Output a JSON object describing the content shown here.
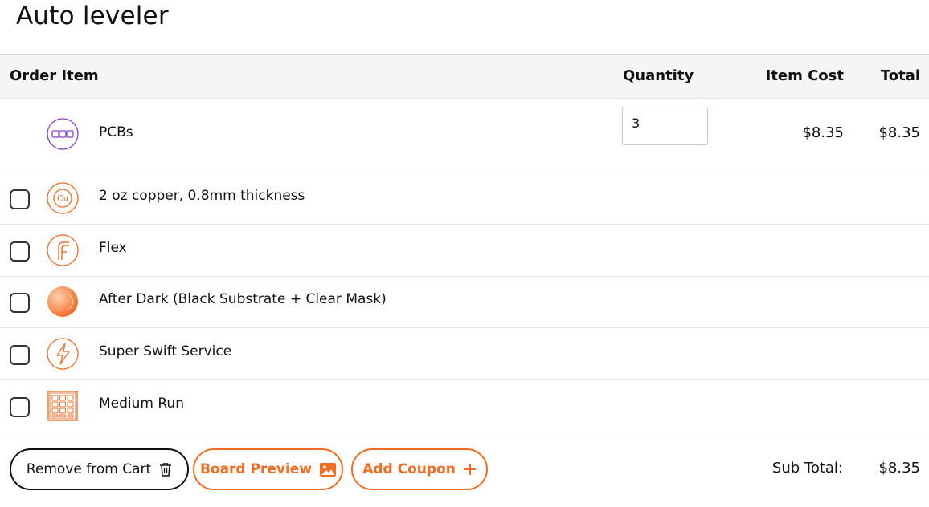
{
  "page_title": "Auto leveler",
  "table": {
    "headers": {
      "item": "Order Item",
      "quantity": "Quantity",
      "item_cost": "Item Cost",
      "total": "Total"
    }
  },
  "main_item": {
    "name": "PCBs",
    "quantity": "3",
    "item_cost": "$8.35",
    "total": "$8.35",
    "icon": "pcb-panel-icon"
  },
  "options": [
    {
      "label": "2 oz copper, 0.8mm thickness",
      "icon": "copper-icon",
      "checked": false
    },
    {
      "label": "Flex",
      "icon": "flex-icon",
      "checked": false
    },
    {
      "label": "After Dark (Black Substrate + Clear Mask)",
      "icon": "after-dark-icon",
      "checked": false
    },
    {
      "label": "Super Swift Service",
      "icon": "lightning-icon",
      "checked": false
    },
    {
      "label": "Medium Run",
      "icon": "medium-run-grid-icon",
      "checked": false
    }
  ],
  "footer": {
    "remove_label": "Remove from Cart",
    "preview_label": "Board Preview",
    "coupon_label": "Add Coupon",
    "subtotal_label": "Sub Total:",
    "subtotal_value": "$8.35"
  },
  "colors": {
    "accent": "#f26b21",
    "purple": "#8a3fd1",
    "text": "#111111",
    "header_bg": "#f5f5f5"
  }
}
